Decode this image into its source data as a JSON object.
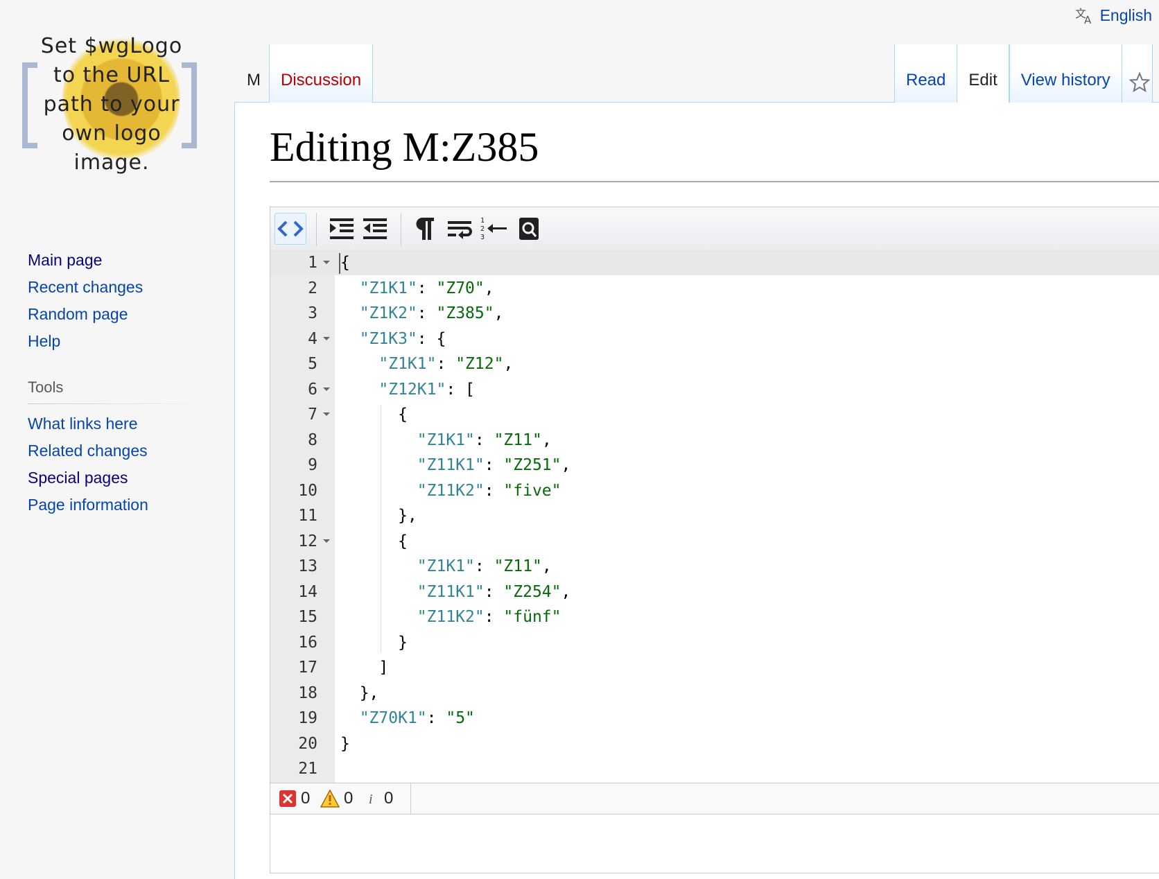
{
  "logo": {
    "lines": [
      "Set $wgLogo",
      "to the URL",
      "path to your",
      "own logo",
      "image."
    ]
  },
  "language": {
    "label": "English",
    "icon": "translate-icon"
  },
  "nav": {
    "items": [
      {
        "label": "Main page"
      },
      {
        "label": "Recent changes"
      },
      {
        "label": "Random page"
      },
      {
        "label": "Help"
      }
    ]
  },
  "tools": {
    "heading": "Tools",
    "items": [
      {
        "label": "What links here"
      },
      {
        "label": "Related changes"
      },
      {
        "label": "Special pages"
      },
      {
        "label": "Page information"
      }
    ]
  },
  "tabs": {
    "namespace": "M",
    "discussion": "Discussion",
    "read": "Read",
    "edit": "Edit",
    "history": "View history",
    "watch_icon": "star-icon"
  },
  "page": {
    "title": "Editing M:Z385"
  },
  "toolbar": {
    "icons": [
      "code-icon",
      "indent-icon",
      "outdent-icon",
      "pilcrow-icon",
      "wrap-icon",
      "goto-line-icon",
      "search-icon"
    ]
  },
  "code": {
    "lines": [
      {
        "n": "1",
        "fold": true,
        "segments": [
          [
            "p",
            "{"
          ]
        ]
      },
      {
        "n": "2",
        "fold": false,
        "segments": [
          [
            "p",
            "  "
          ],
          [
            "k",
            "\"Z1K1\""
          ],
          [
            "p",
            ": "
          ],
          [
            "s",
            "\"Z70\""
          ],
          [
            "p",
            ","
          ]
        ]
      },
      {
        "n": "3",
        "fold": false,
        "segments": [
          [
            "p",
            "  "
          ],
          [
            "k",
            "\"Z1K2\""
          ],
          [
            "p",
            ": "
          ],
          [
            "s",
            "\"Z385\""
          ],
          [
            "p",
            ","
          ]
        ]
      },
      {
        "n": "4",
        "fold": true,
        "segments": [
          [
            "p",
            "  "
          ],
          [
            "k",
            "\"Z1K3\""
          ],
          [
            "p",
            ": {"
          ]
        ]
      },
      {
        "n": "5",
        "fold": false,
        "segments": [
          [
            "p",
            "    "
          ],
          [
            "k",
            "\"Z1K1\""
          ],
          [
            "p",
            ": "
          ],
          [
            "s",
            "\"Z12\""
          ],
          [
            "p",
            ","
          ]
        ]
      },
      {
        "n": "6",
        "fold": true,
        "segments": [
          [
            "p",
            "    "
          ],
          [
            "k",
            "\"Z12K1\""
          ],
          [
            "p",
            ": ["
          ]
        ]
      },
      {
        "n": "7",
        "fold": true,
        "segments": [
          [
            "p",
            "      {"
          ]
        ]
      },
      {
        "n": "8",
        "fold": false,
        "segments": [
          [
            "p",
            "        "
          ],
          [
            "k",
            "\"Z1K1\""
          ],
          [
            "p",
            ": "
          ],
          [
            "s",
            "\"Z11\""
          ],
          [
            "p",
            ","
          ]
        ]
      },
      {
        "n": "9",
        "fold": false,
        "segments": [
          [
            "p",
            "        "
          ],
          [
            "k",
            "\"Z11K1\""
          ],
          [
            "p",
            ": "
          ],
          [
            "s",
            "\"Z251\""
          ],
          [
            "p",
            ","
          ]
        ]
      },
      {
        "n": "10",
        "fold": false,
        "segments": [
          [
            "p",
            "        "
          ],
          [
            "k",
            "\"Z11K2\""
          ],
          [
            "p",
            ": "
          ],
          [
            "s",
            "\"five\""
          ]
        ]
      },
      {
        "n": "11",
        "fold": false,
        "segments": [
          [
            "p",
            "      },"
          ]
        ]
      },
      {
        "n": "12",
        "fold": true,
        "segments": [
          [
            "p",
            "      {"
          ]
        ]
      },
      {
        "n": "13",
        "fold": false,
        "segments": [
          [
            "p",
            "        "
          ],
          [
            "k",
            "\"Z1K1\""
          ],
          [
            "p",
            ": "
          ],
          [
            "s",
            "\"Z11\""
          ],
          [
            "p",
            ","
          ]
        ]
      },
      {
        "n": "14",
        "fold": false,
        "segments": [
          [
            "p",
            "        "
          ],
          [
            "k",
            "\"Z11K1\""
          ],
          [
            "p",
            ": "
          ],
          [
            "s",
            "\"Z254\""
          ],
          [
            "p",
            ","
          ]
        ]
      },
      {
        "n": "15",
        "fold": false,
        "segments": [
          [
            "p",
            "        "
          ],
          [
            "k",
            "\"Z11K2\""
          ],
          [
            "p",
            ": "
          ],
          [
            "s",
            "\"fünf\""
          ]
        ]
      },
      {
        "n": "16",
        "fold": false,
        "segments": [
          [
            "p",
            "      }"
          ]
        ]
      },
      {
        "n": "17",
        "fold": false,
        "segments": [
          [
            "p",
            "    ]"
          ]
        ]
      },
      {
        "n": "18",
        "fold": false,
        "segments": [
          [
            "p",
            "  },"
          ]
        ]
      },
      {
        "n": "19",
        "fold": false,
        "segments": [
          [
            "p",
            "  "
          ],
          [
            "k",
            "\"Z70K1\""
          ],
          [
            "p",
            ": "
          ],
          [
            "s",
            "\"5\""
          ]
        ]
      },
      {
        "n": "20",
        "fold": false,
        "segments": [
          [
            "p",
            "}"
          ]
        ]
      },
      {
        "n": "21",
        "fold": false,
        "segments": []
      }
    ]
  },
  "status": {
    "errors": "0",
    "warnings": "0",
    "info": "0"
  },
  "colors": {
    "link": "#0645ad",
    "visited": "#0b0080",
    "key": "#318495",
    "string": "#036a07",
    "red_link": "#ba0000"
  }
}
